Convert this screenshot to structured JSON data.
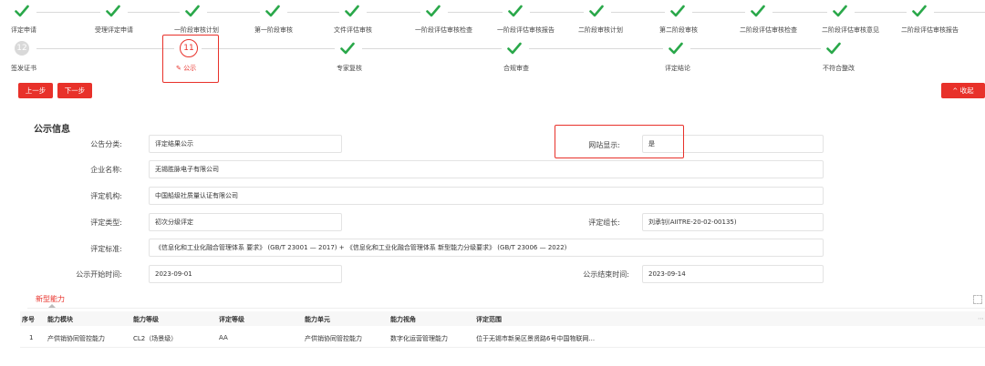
{
  "steps_row1": [
    {
      "label": "评定申请"
    },
    {
      "label": "受理评定申请"
    },
    {
      "label": "一阶段审核计划"
    },
    {
      "label": "第一阶段审核"
    },
    {
      "label": "文件评估审核"
    },
    {
      "label": "一阶段评估审核检查"
    },
    {
      "label": "一阶段评估审核报告"
    },
    {
      "label": "二阶段审核计划"
    },
    {
      "label": "第二阶段审核"
    },
    {
      "label": "二阶段评估审核检查"
    },
    {
      "label": "二阶段评估审核意见"
    },
    {
      "label": "二阶段评估审核报告"
    }
  ],
  "steps_row2": [
    {
      "number": "12",
      "label": "签发证书"
    },
    {
      "number": "11",
      "label": "公示",
      "icon_label": "✎",
      "current": true
    },
    {
      "label": "专家复核"
    },
    {
      "label": "合规审查"
    },
    {
      "label": "评定结论"
    },
    {
      "label": "不符合整改"
    }
  ],
  "buttons": {
    "prev": "上一步",
    "next": "下一步",
    "collapse": "收起"
  },
  "section_title": "公示信息",
  "form": {
    "category_label": "公告分类:",
    "category_value": "评定结果公示",
    "website_label": "网站显示:",
    "website_value": "是",
    "company_label": "企业名称:",
    "company_value": "无锡胜脉电子有限公司",
    "org_label": "评定机构:",
    "org_value": "中国船级社质量认证有限公司",
    "type_label": "评定类型:",
    "type_value": "初次分级评定",
    "leader_label": "评定组长:",
    "leader_value": "刘承钊(AIITRE-20-02-00135)",
    "standard_label": "评定标准:",
    "standard_value": "《信息化和工业化融合管理体系 要求》 (GB/T 23001 — 2017) + 《信息化和工业化融合管理体系 新型能力分级要求》 (GB/T 23006 — 2022)",
    "start_label": "公示开始时间:",
    "start_value": "2023-09-01",
    "end_label": "公示结束时间:",
    "end_value": "2023-09-14"
  },
  "tab": "新型能力",
  "table": {
    "headers": [
      "序号",
      "能力模块",
      "能力等级",
      "评定等级",
      "能力单元",
      "能力视角",
      "评定范围"
    ],
    "rows": [
      [
        "1",
        "产供销协同管控能力",
        "CL2（场景级）",
        "AA",
        "产供销协同管控能力",
        "数字化运营管理能力",
        "位于无锡市新吴区景贤路6号中国物联网..."
      ]
    ]
  },
  "colors": {
    "accent": "#e8312a",
    "check": "#2aa84a",
    "line": "#d9d9d9"
  }
}
